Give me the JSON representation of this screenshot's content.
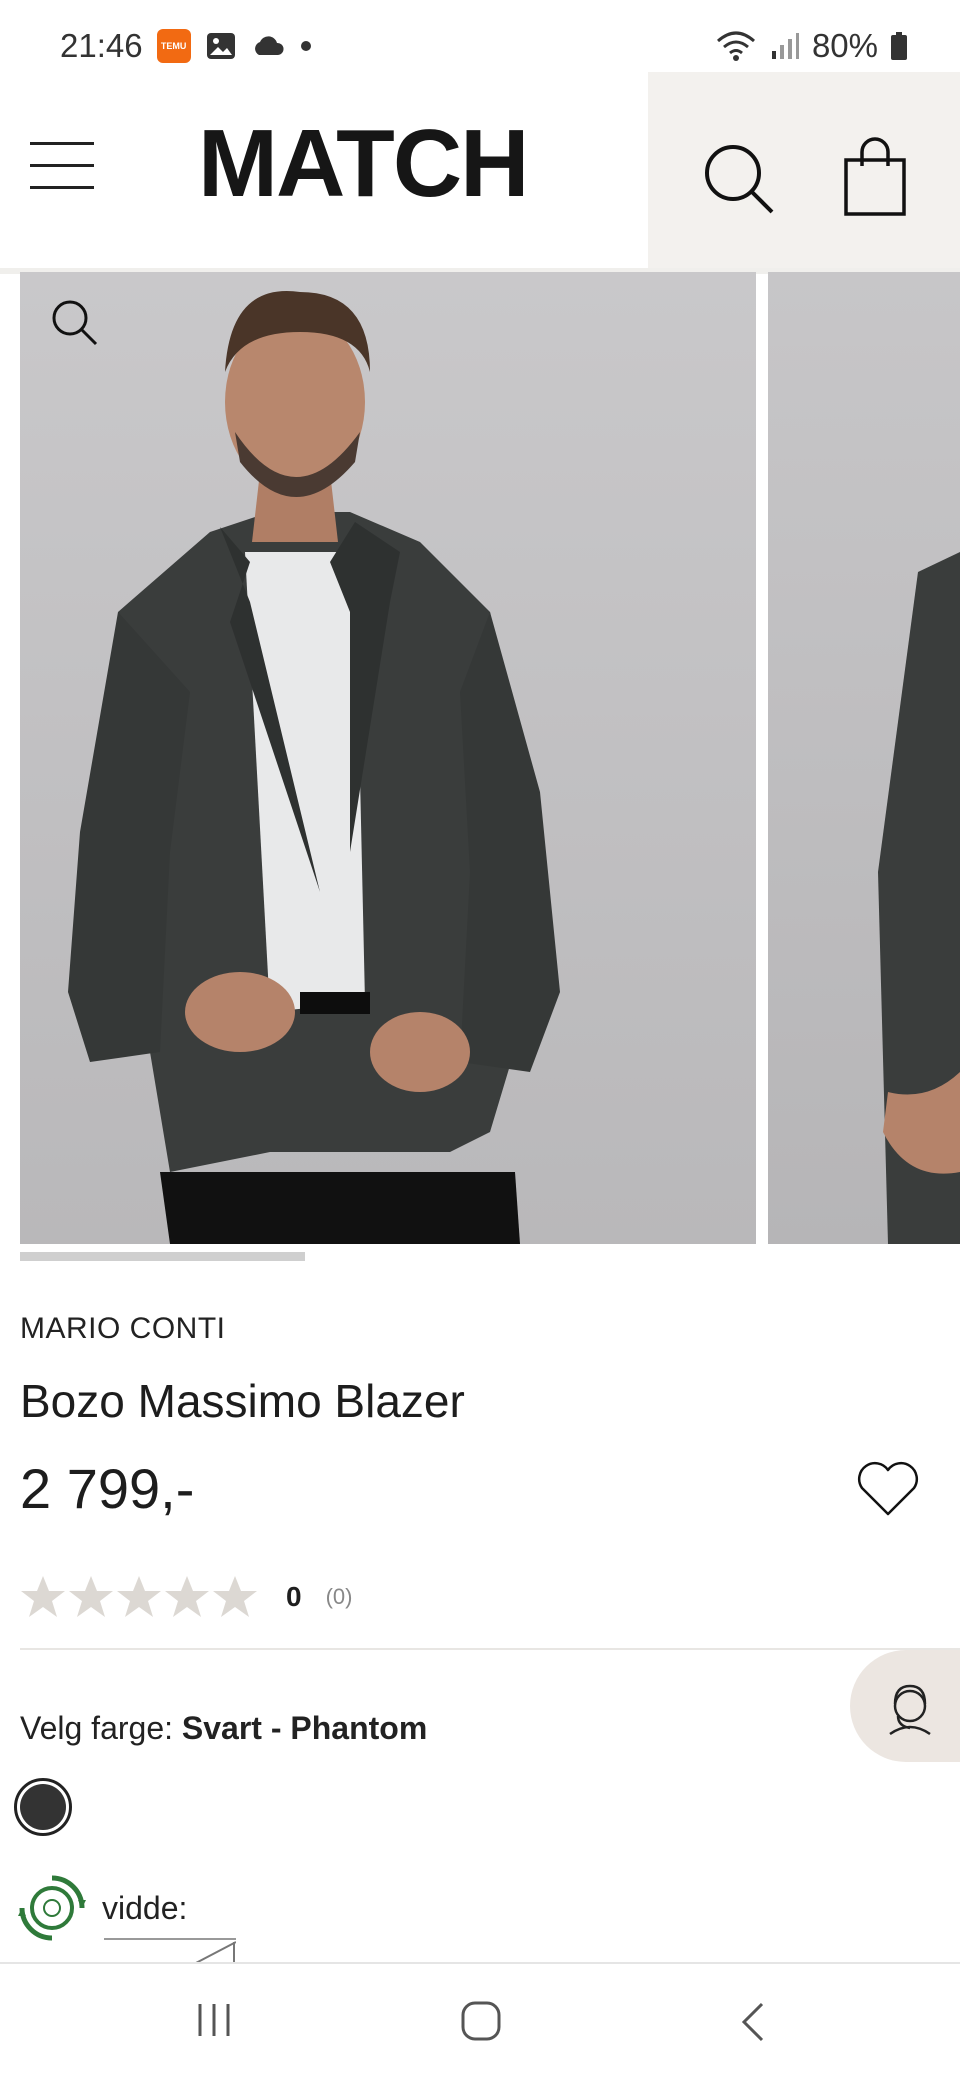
{
  "status_bar": {
    "time": "21:46",
    "battery": "80%",
    "temu_badge": "TEMU"
  },
  "header": {
    "logo": "MATCH"
  },
  "product": {
    "brand": "MARIO CONTI",
    "name": "Bozo Massimo Blazer",
    "price": "2 799,-",
    "rating_value": "0",
    "rating_count": "(0)",
    "stars_filled": 0,
    "stars_total": 5,
    "color_label": "Velg farge: ",
    "color_value": "Svart - Phantom",
    "size_label": "vidde:"
  },
  "gallery": {
    "progress_fraction": 0.31
  },
  "colors": {
    "swatch": "#333333",
    "star_empty": "#dcd8d3",
    "header_right_bg": "#f3f1ee"
  },
  "icons": [
    "menu-icon",
    "search-icon",
    "bag-icon",
    "zoom-icon",
    "heart-icon",
    "star-icon",
    "chat-agent-icon",
    "eco-icon",
    "nav-recents-icon",
    "nav-home-icon",
    "nav-back-icon"
  ]
}
